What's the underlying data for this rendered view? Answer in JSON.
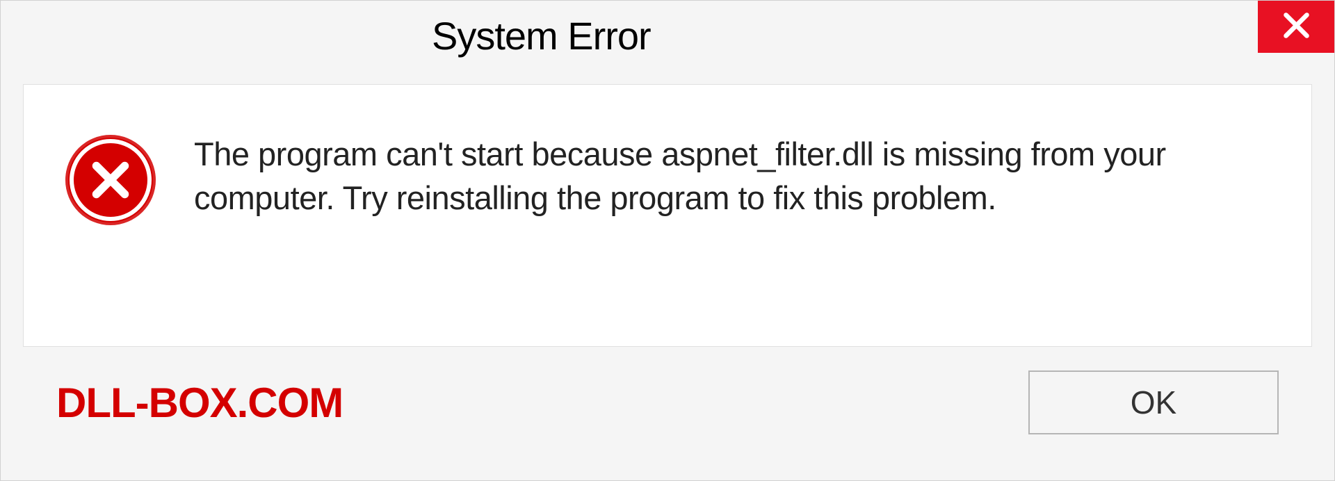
{
  "dialog": {
    "title": "System Error",
    "message": "The program can't start because aspnet_filter.dll is missing from your computer. Try reinstalling the program to fix this problem.",
    "ok_label": "OK",
    "watermark": "DLL-BOX.COM"
  }
}
